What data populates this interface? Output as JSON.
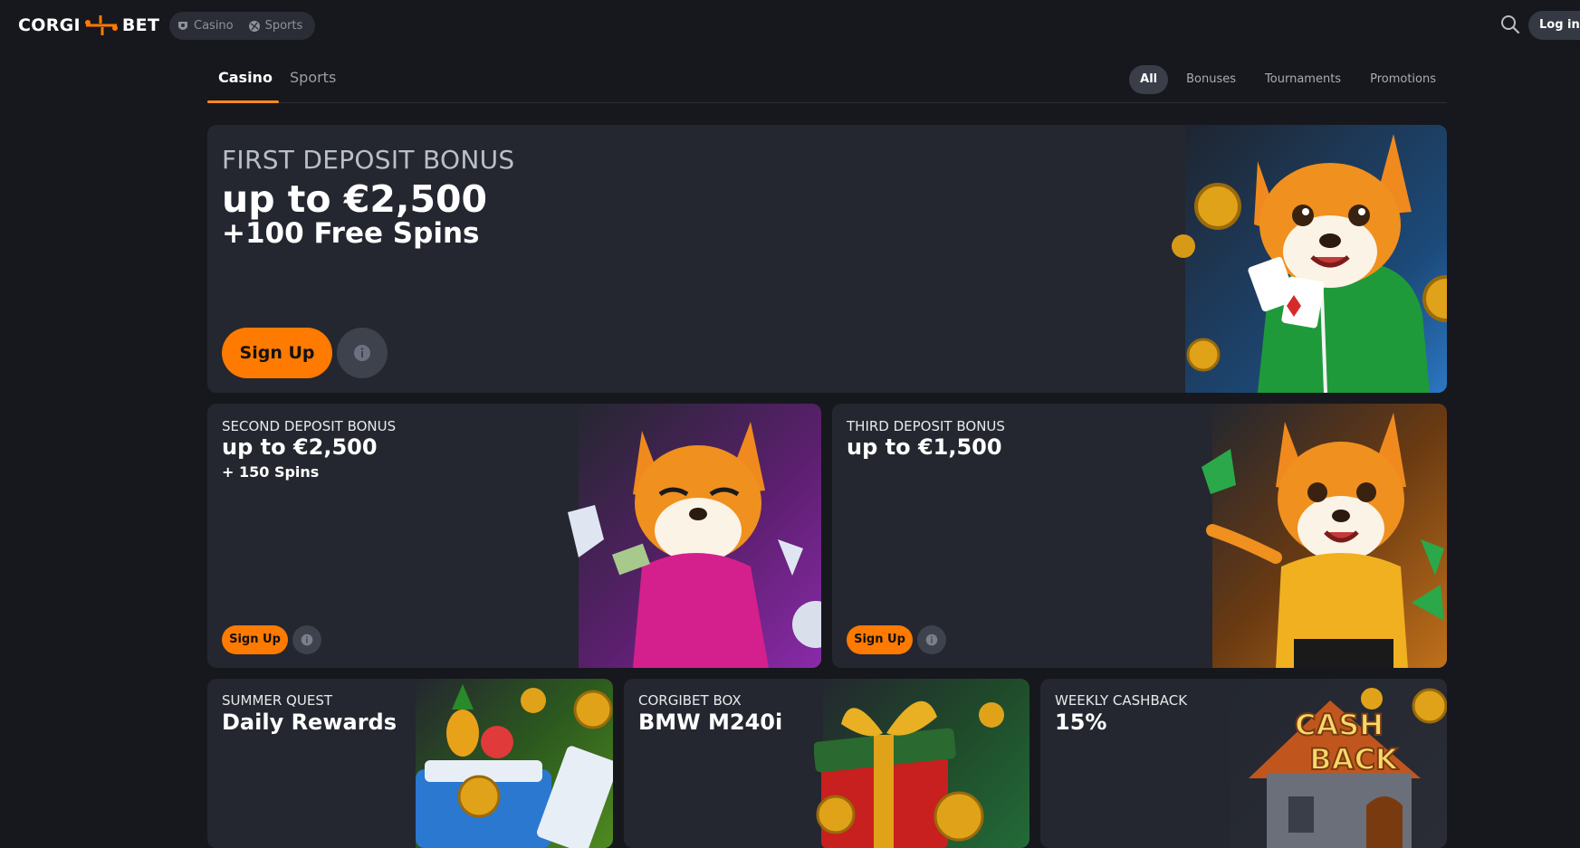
{
  "brand": {
    "logo_left": "CORGI",
    "logo_right": "BET",
    "accent": "#ff7a00"
  },
  "header": {
    "switch": [
      {
        "label": "Casino",
        "icon": "casino-chip-icon"
      },
      {
        "label": "Sports",
        "icon": "soccer-ball-icon"
      }
    ],
    "search_icon": "search-icon",
    "login_label": "Log in"
  },
  "tabs": [
    {
      "label": "Casino",
      "active": true
    },
    {
      "label": "Sports",
      "active": false
    }
  ],
  "filters": [
    {
      "label": "All",
      "active": true
    },
    {
      "label": "Bonuses",
      "active": false
    },
    {
      "label": "Tournaments",
      "active": false
    },
    {
      "label": "Promotions",
      "active": false
    }
  ],
  "promos": {
    "first": {
      "kicker": "FIRST DEPOSIT BONUS",
      "headline": "up to €2,500",
      "sub": "+100 Free Spins",
      "cta": "Sign Up",
      "info_icon": "info-icon"
    },
    "second": {
      "kicker": "SECOND DEPOSIT BONUS",
      "headline": "up to €2,500",
      "sub": "+ 150 Spins",
      "cta": "Sign Up",
      "info_icon": "info-icon"
    },
    "third": {
      "kicker": "THIRD DEPOSIT BONUS",
      "headline": "up to €1,500",
      "cta": "Sign Up",
      "info_icon": "info-icon"
    },
    "summer": {
      "kicker": "SUMMER QUEST",
      "headline": "Daily Rewards"
    },
    "box": {
      "kicker": "CORGIBET BOX",
      "headline": "BMW M240i"
    },
    "cashback": {
      "kicker": "WEEKLY CASHBACK",
      "headline": "15%",
      "art_text_1": "CASH",
      "art_text_2": "BACK"
    }
  }
}
